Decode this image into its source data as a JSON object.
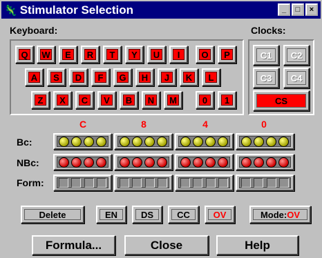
{
  "window": {
    "title": "Stimulator Selection",
    "min": "_",
    "max": "□",
    "close": "×"
  },
  "keyboard": {
    "label": "Keyboard:",
    "row1": [
      "Q",
      "W",
      "E",
      "R",
      "T",
      "Y",
      "U",
      "I",
      "O",
      "P"
    ],
    "row2": [
      "A",
      "S",
      "D",
      "F",
      "G",
      "H",
      "J",
      "K",
      "L"
    ],
    "row3": [
      "Z",
      "X",
      "C",
      "V",
      "B",
      "N",
      "M",
      "0",
      "1"
    ]
  },
  "clocks": {
    "label": "Clocks:",
    "buttons": [
      "C1",
      "C2",
      "C3",
      "C4",
      "CS"
    ]
  },
  "registers": {
    "hex_digits": [
      "C",
      "8",
      "4",
      "0"
    ],
    "rows": [
      {
        "label": "Bc:",
        "kind": "yellow-led"
      },
      {
        "label": "NBc:",
        "kind": "red-led"
      },
      {
        "label": "Form:",
        "kind": "square"
      }
    ]
  },
  "actions": {
    "delete": "Delete",
    "en": "EN",
    "ds": "DS",
    "cc": "CC",
    "ov": "OV",
    "mode_label": "Mode:",
    "mode_value": "OV"
  },
  "footer": {
    "formula": "Formula...",
    "close": "Close",
    "help": "Help"
  }
}
